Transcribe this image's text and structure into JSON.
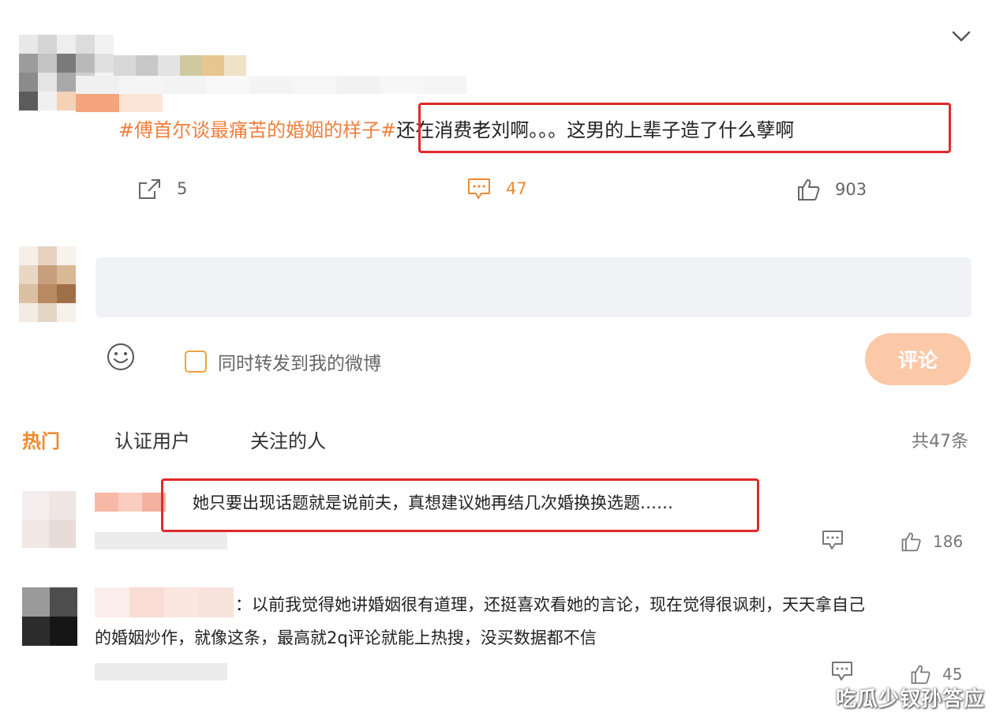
{
  "post": {
    "hashtag": "#傅首尔谈最痛苦的婚姻的样子#",
    "text": "还在消费老刘啊。。。这男的上辈子造了什么孽啊",
    "actions": {
      "share_count": "5",
      "comment_count": "47",
      "like_count": "903"
    }
  },
  "composer": {
    "placeholder": "",
    "repost_label": "同时转发到我的微博",
    "submit_label": "评论"
  },
  "comments_tabs": {
    "tabs": [
      "热门",
      "认证用户",
      "关注的人"
    ],
    "total": "共47条"
  },
  "comments": [
    {
      "text": "她只要出现话题就是说前夫，真想建议她再结几次婚换换选题……",
      "like_count": "186"
    },
    {
      "text_line1": "：以前我觉得她讲婚姻很有道理，还挺喜欢看她的言论，现在觉得很讽刺，天天拿自己",
      "text_line2": "的婚姻炒作，就像这条，最高就2q评论就能上热搜，没买数据都不信",
      "like_count": "45"
    }
  ],
  "watermark": "吃瓜少钗孙答应",
  "colors": {
    "accent_orange": "#f08a2e",
    "highlight_red": "#e02a2a",
    "button_disabled": "#fbc8a8",
    "input_bg": "#f1f2f5"
  }
}
